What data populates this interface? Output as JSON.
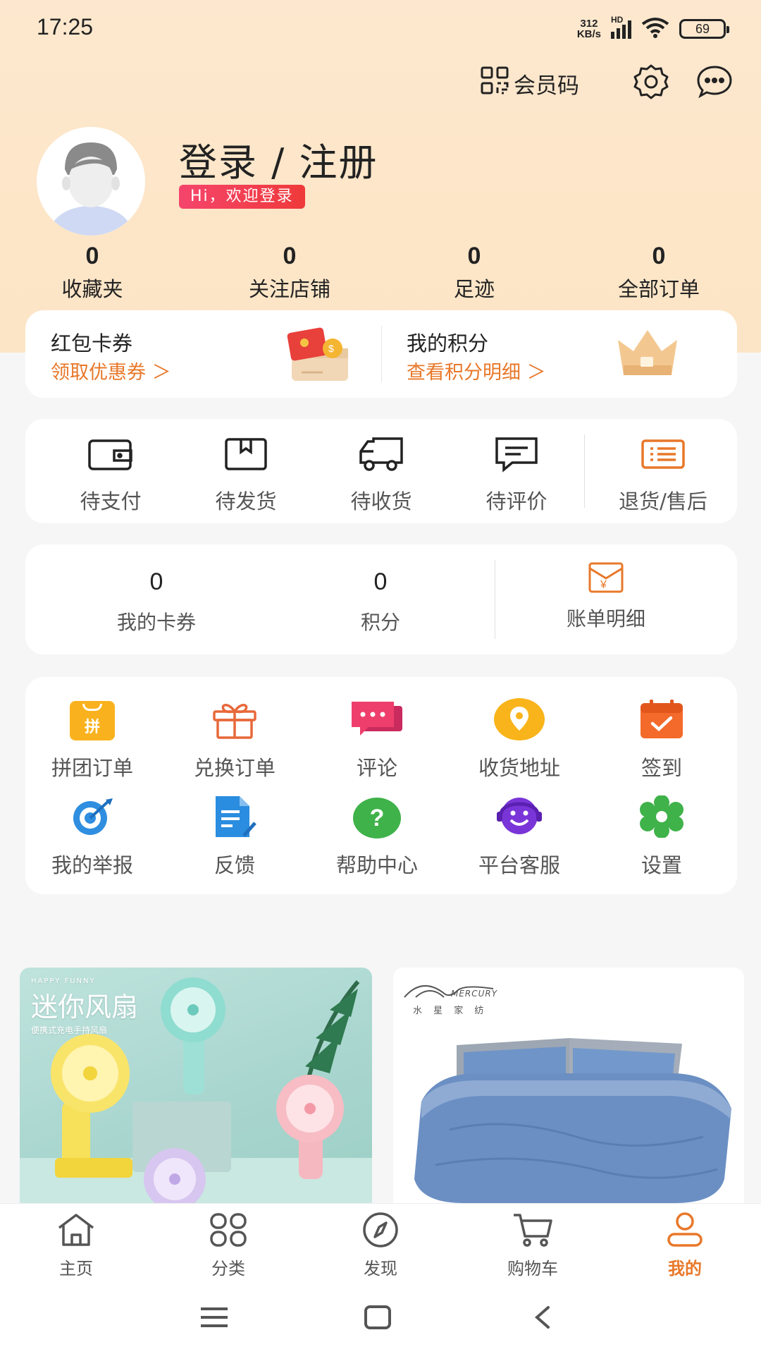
{
  "status_bar": {
    "time": "17:25",
    "net_speed_value": "312",
    "net_speed_unit": "KB/s",
    "network_type": "HD",
    "battery": "69"
  },
  "top_actions": {
    "member_code": "会员码"
  },
  "profile": {
    "title": "登录 / 注册",
    "welcome": "Hi，欢迎登录"
  },
  "stats": [
    {
      "value": "0",
      "label": "收藏夹"
    },
    {
      "value": "0",
      "label": "关注店铺"
    },
    {
      "value": "0",
      "label": "足迹"
    },
    {
      "value": "0",
      "label": "全部订单"
    }
  ],
  "promo": {
    "coupons": {
      "title": "红包卡券",
      "link": "领取优惠券 ＞"
    },
    "points": {
      "title": "我的积分",
      "link": "查看积分明细 ＞"
    }
  },
  "orders": [
    {
      "label": "待支付",
      "icon": "wallet-icon"
    },
    {
      "label": "待发货",
      "icon": "package-icon"
    },
    {
      "label": "待收货",
      "icon": "truck-icon"
    },
    {
      "label": "待评价",
      "icon": "comment-icon"
    },
    {
      "label": "退货/售后",
      "icon": "return-list-icon"
    }
  ],
  "wallet": {
    "cards": {
      "value": "0",
      "label": "我的卡券"
    },
    "points": {
      "value": "0",
      "label": "积分"
    },
    "bill": {
      "label": "账单明细"
    }
  },
  "services": [
    {
      "label": "拼团订单",
      "icon": "group-order-icon",
      "glyph": "拼"
    },
    {
      "label": "兑换订单",
      "icon": "gift-icon"
    },
    {
      "label": "评论",
      "icon": "chat-icon"
    },
    {
      "label": "收货地址",
      "icon": "location-icon"
    },
    {
      "label": "签到",
      "icon": "calendar-check-icon"
    },
    {
      "label": "我的举报",
      "icon": "report-target-icon"
    },
    {
      "label": "反馈",
      "icon": "feedback-icon"
    },
    {
      "label": "帮助中心",
      "icon": "help-icon",
      "glyph": "?"
    },
    {
      "label": "平台客服",
      "icon": "customer-service-icon"
    },
    {
      "label": "设置",
      "icon": "settings-icon"
    }
  ],
  "banners": {
    "fan": {
      "title": "迷你风扇",
      "tag": "HAPPY FUNNY",
      "subtitle": "便携式充电手持风扇"
    },
    "bed": {
      "brand": "水 星 家 纺",
      "logo": "MERCURY"
    }
  },
  "bottom_nav": [
    {
      "label": "主页",
      "icon": "home-icon",
      "active": false
    },
    {
      "label": "分类",
      "icon": "category-icon",
      "active": false
    },
    {
      "label": "发现",
      "icon": "compass-icon",
      "active": false
    },
    {
      "label": "购物车",
      "icon": "cart-icon",
      "active": false
    },
    {
      "label": "我的",
      "icon": "profile-icon",
      "active": true
    }
  ],
  "colors": {
    "accent": "#e8782a",
    "header_bg": "#fde7cb",
    "badge": "#f0425a"
  }
}
